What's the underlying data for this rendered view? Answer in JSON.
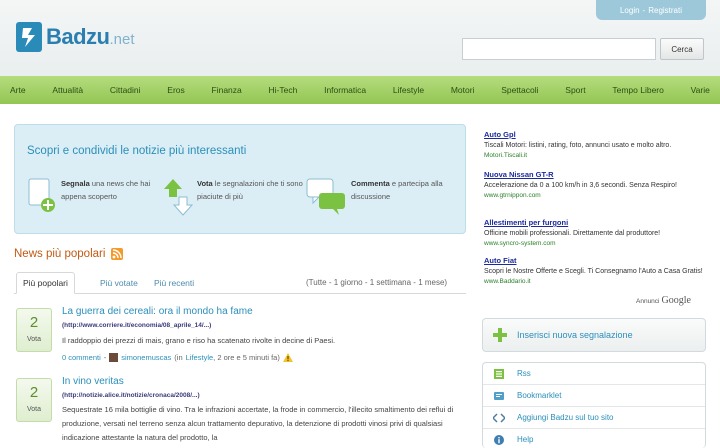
{
  "header": {
    "logo_name": "Badzu",
    "logo_tld": ".net",
    "login": "Login",
    "separator": "-",
    "register": "Registrati",
    "search_placeholder": "",
    "search_button": "Cerca"
  },
  "nav": [
    "Arte",
    "Attualità",
    "Cittadini",
    "Eros",
    "Finanza",
    "Hi-Tech",
    "Informatica",
    "Lifestyle",
    "Motori",
    "Spettacoli",
    "Sport",
    "Tempo Libero",
    "Varie"
  ],
  "intro": {
    "title": "Scopri e condividi le notizie più interessanti",
    "features": [
      {
        "icon": "document-add-icon",
        "bold": "Segnala",
        "text": " una news che hai appena scoperto"
      },
      {
        "icon": "vote-arrows-icon",
        "bold": "Vota",
        "text": " le segnalazioni che ti sono piaciute di più"
      },
      {
        "icon": "speech-bubbles-icon",
        "bold": "Commenta",
        "text": " e partecipa alla discussione"
      }
    ]
  },
  "news": {
    "heading": "News più popolari",
    "tabs": [
      "Più popolari",
      "Più votate",
      "Più recenti"
    ],
    "periods": "(Tutte - 1 giorno - 1 settimana - 1 mese)",
    "stories": [
      {
        "votes": "2",
        "vote_label": "Vota",
        "title": "La guerra dei cereali: ora il mondo ha fame",
        "url": "(http://www.corriere.it/economia/08_aprile_14/...)",
        "body": "Il raddoppio dei prezzi di mais, grano e riso ha scatenato rivolte in decine di Paesi.",
        "comments": "0 commenti",
        "separator": "-",
        "user": "simonemuscas",
        "category_prefix": "(in",
        "category": "Lifestyle",
        "time": ", 2 ore e 5 minuti fa)"
      },
      {
        "votes": "2",
        "vote_label": "Vota",
        "title": "In vino veritas",
        "url": "(http://notizie.alice.it/notizie/cronaca/2008/...)",
        "body": "Sequestrate 16 mila bottiglie di vino. Tra le infrazioni accertate, la frode in commercio, l'illecito smaltimento dei reflui di produzione, versati nel terreno senza alcun trattamento depurativo, la detenzione di prodotti vinosi privi di qualsiasi indicazione attestante la natura del prodotto, la"
      }
    ]
  },
  "ads": [
    {
      "title": "Auto Gpl",
      "desc": "Tiscali Motori: listini, rating, foto, annunci usato e molto altro.",
      "url": "Motori.Tiscali.it"
    },
    {
      "title": "Nuova Nissan GT-R",
      "desc": "Accelerazione da 0 a 100 km/h in 3,6 secondi. Senza Respiro!",
      "url": "www.gtrnippon.com"
    },
    {
      "title": "Allestimenti per furgoni",
      "desc": "Officine mobili professionali. Direttamente dal produttore!",
      "url": "www.syncro-system.com"
    },
    {
      "title": "Auto Fiat",
      "desc": "Scopri le Nostre Offerte e Scegli. Ti Consegnamo l'Auto a Casa Gratis!",
      "url": "www.Baddario.it"
    }
  ],
  "ads_footer": {
    "prefix": "Annunci",
    "brand": "Google"
  },
  "sidebar": {
    "insert_button": "Inserisci nuova segnalazione",
    "items": [
      {
        "icon": "rss-icon",
        "label": "Rss"
      },
      {
        "icon": "bookmark-icon",
        "label": "Bookmarklet"
      },
      {
        "icon": "code-icon",
        "label": "Aggiungi Badzu sul tuo sito"
      },
      {
        "icon": "help-icon",
        "label": "Help"
      }
    ]
  },
  "colors": {
    "accent_blue": "#2a8fba",
    "nav_green": "#93c653",
    "heading_orange": "#c25a14",
    "ad_link": "#1c2a9c"
  }
}
